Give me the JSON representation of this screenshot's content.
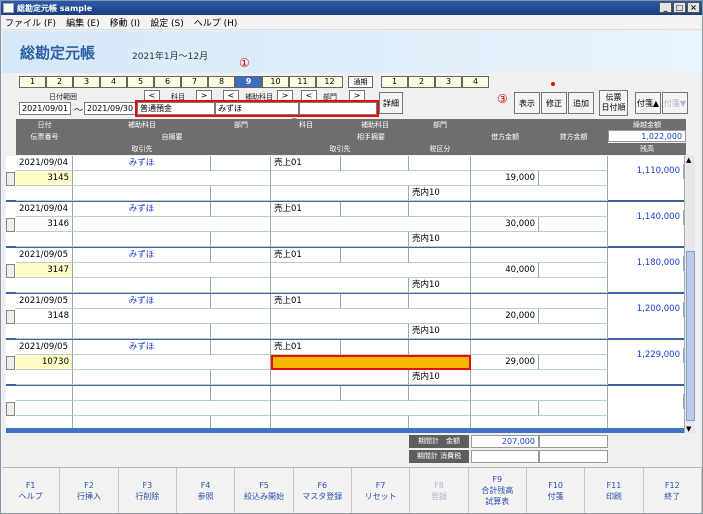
{
  "window": {
    "title": "総勘定元帳 sample"
  },
  "menu": [
    "ファイル (F)",
    "編集 (E)",
    "移動 (I)",
    "設定 (S)",
    "ヘルプ (H)"
  ],
  "header": {
    "title": "総勘定元帳",
    "period": "2021年1月～12月"
  },
  "markers": {
    "m1": "①",
    "m2": "②",
    "m3": "③"
  },
  "months": [
    "1",
    "2",
    "3",
    "4",
    "5",
    "6",
    "7",
    "8",
    "9",
    "10",
    "11",
    "12"
  ],
  "active_month": "9",
  "tsuki_label": "通期",
  "quarters": [
    "1",
    "2",
    "3",
    "4"
  ],
  "filter": {
    "date_range_label": "日付範囲",
    "date_from": "2021/09/01",
    "tilde": "～",
    "date_to": "2021/09/30",
    "kamoku_label": "科目",
    "hojo_label": "補助科目",
    "bumon_label": "部門",
    "account": "普通預金",
    "sub_account": "みずほ",
    "detail_btn": "詳細"
  },
  "toolbar": {
    "show": "表示",
    "edit": "修正",
    "add": "追加",
    "slip_order": "伝票\n日付順",
    "sort_asc": "付箋▲",
    "sort_desc": "付箋▼"
  },
  "columns": {
    "date": "日付",
    "slip_no": "伝票番号",
    "sub_account": "補助科目",
    "dept": "部門",
    "own_summary": "自摘要",
    "counter_account": "科目",
    "counter_sub": "補助科目",
    "counter_dept": "部門",
    "counter_summary": "相手摘要",
    "debit": "借方金額",
    "credit": "貸方金額",
    "carry_label": "繰越金額",
    "carry_value": "1,022,000",
    "partner": "取引先",
    "partner2": "取引先",
    "tax_class": "税区分",
    "balance": "残高"
  },
  "rows": [
    {
      "date": "2021/09/04",
      "slip": "3145",
      "sub": "みずほ",
      "counter": "売上01",
      "tax": "売内10",
      "debit": "19,000",
      "balance": "1,110,000"
    },
    {
      "date": "2021/09/04",
      "slip": "3146",
      "sub": "みずほ",
      "counter": "売上01",
      "tax": "売内10",
      "debit": "30,000",
      "balance": "1,140,000"
    },
    {
      "date": "2021/09/05",
      "slip": "3147",
      "sub": "みずほ",
      "counter": "売上01",
      "tax": "売内10",
      "debit": "40,000",
      "balance": "1,180,000"
    },
    {
      "date": "2021/09/05",
      "slip": "3148",
      "sub": "みずほ",
      "counter": "売上01",
      "tax": "売内10",
      "debit": "20,000",
      "balance": "1,200,000"
    },
    {
      "date": "2021/09/05",
      "slip": "10730",
      "sub": "みずほ",
      "counter": "売上01",
      "tax": "売内10",
      "debit": "29,000",
      "balance": "1,229,000"
    }
  ],
  "totals": {
    "period_total_label": "期間計　金額",
    "period_total_value": "207,000",
    "period_tax_label": "期間計 消費税",
    "period_tax_value": ""
  },
  "fkeys": [
    {
      "key": "F1",
      "label": "ヘルプ"
    },
    {
      "key": "F2",
      "label": "行挿入"
    },
    {
      "key": "F3",
      "label": "行削除"
    },
    {
      "key": "F4",
      "label": "参照"
    },
    {
      "key": "F5",
      "label": "絞込み開始"
    },
    {
      "key": "F6",
      "label": "マスタ登録"
    },
    {
      "key": "F7",
      "label": "リセット"
    },
    {
      "key": "F8",
      "label": "登録"
    },
    {
      "key": "F9",
      "label": "合計残高\n試算表"
    },
    {
      "key": "F10",
      "label": "付箋"
    },
    {
      "key": "F11",
      "label": "印刷"
    },
    {
      "key": "F12",
      "label": "終了"
    }
  ],
  "colors": {
    "accent": "#3a6fc0",
    "highlight": "#f8b800",
    "slip_bg": "#fffcc8",
    "marker": "#e01010"
  }
}
